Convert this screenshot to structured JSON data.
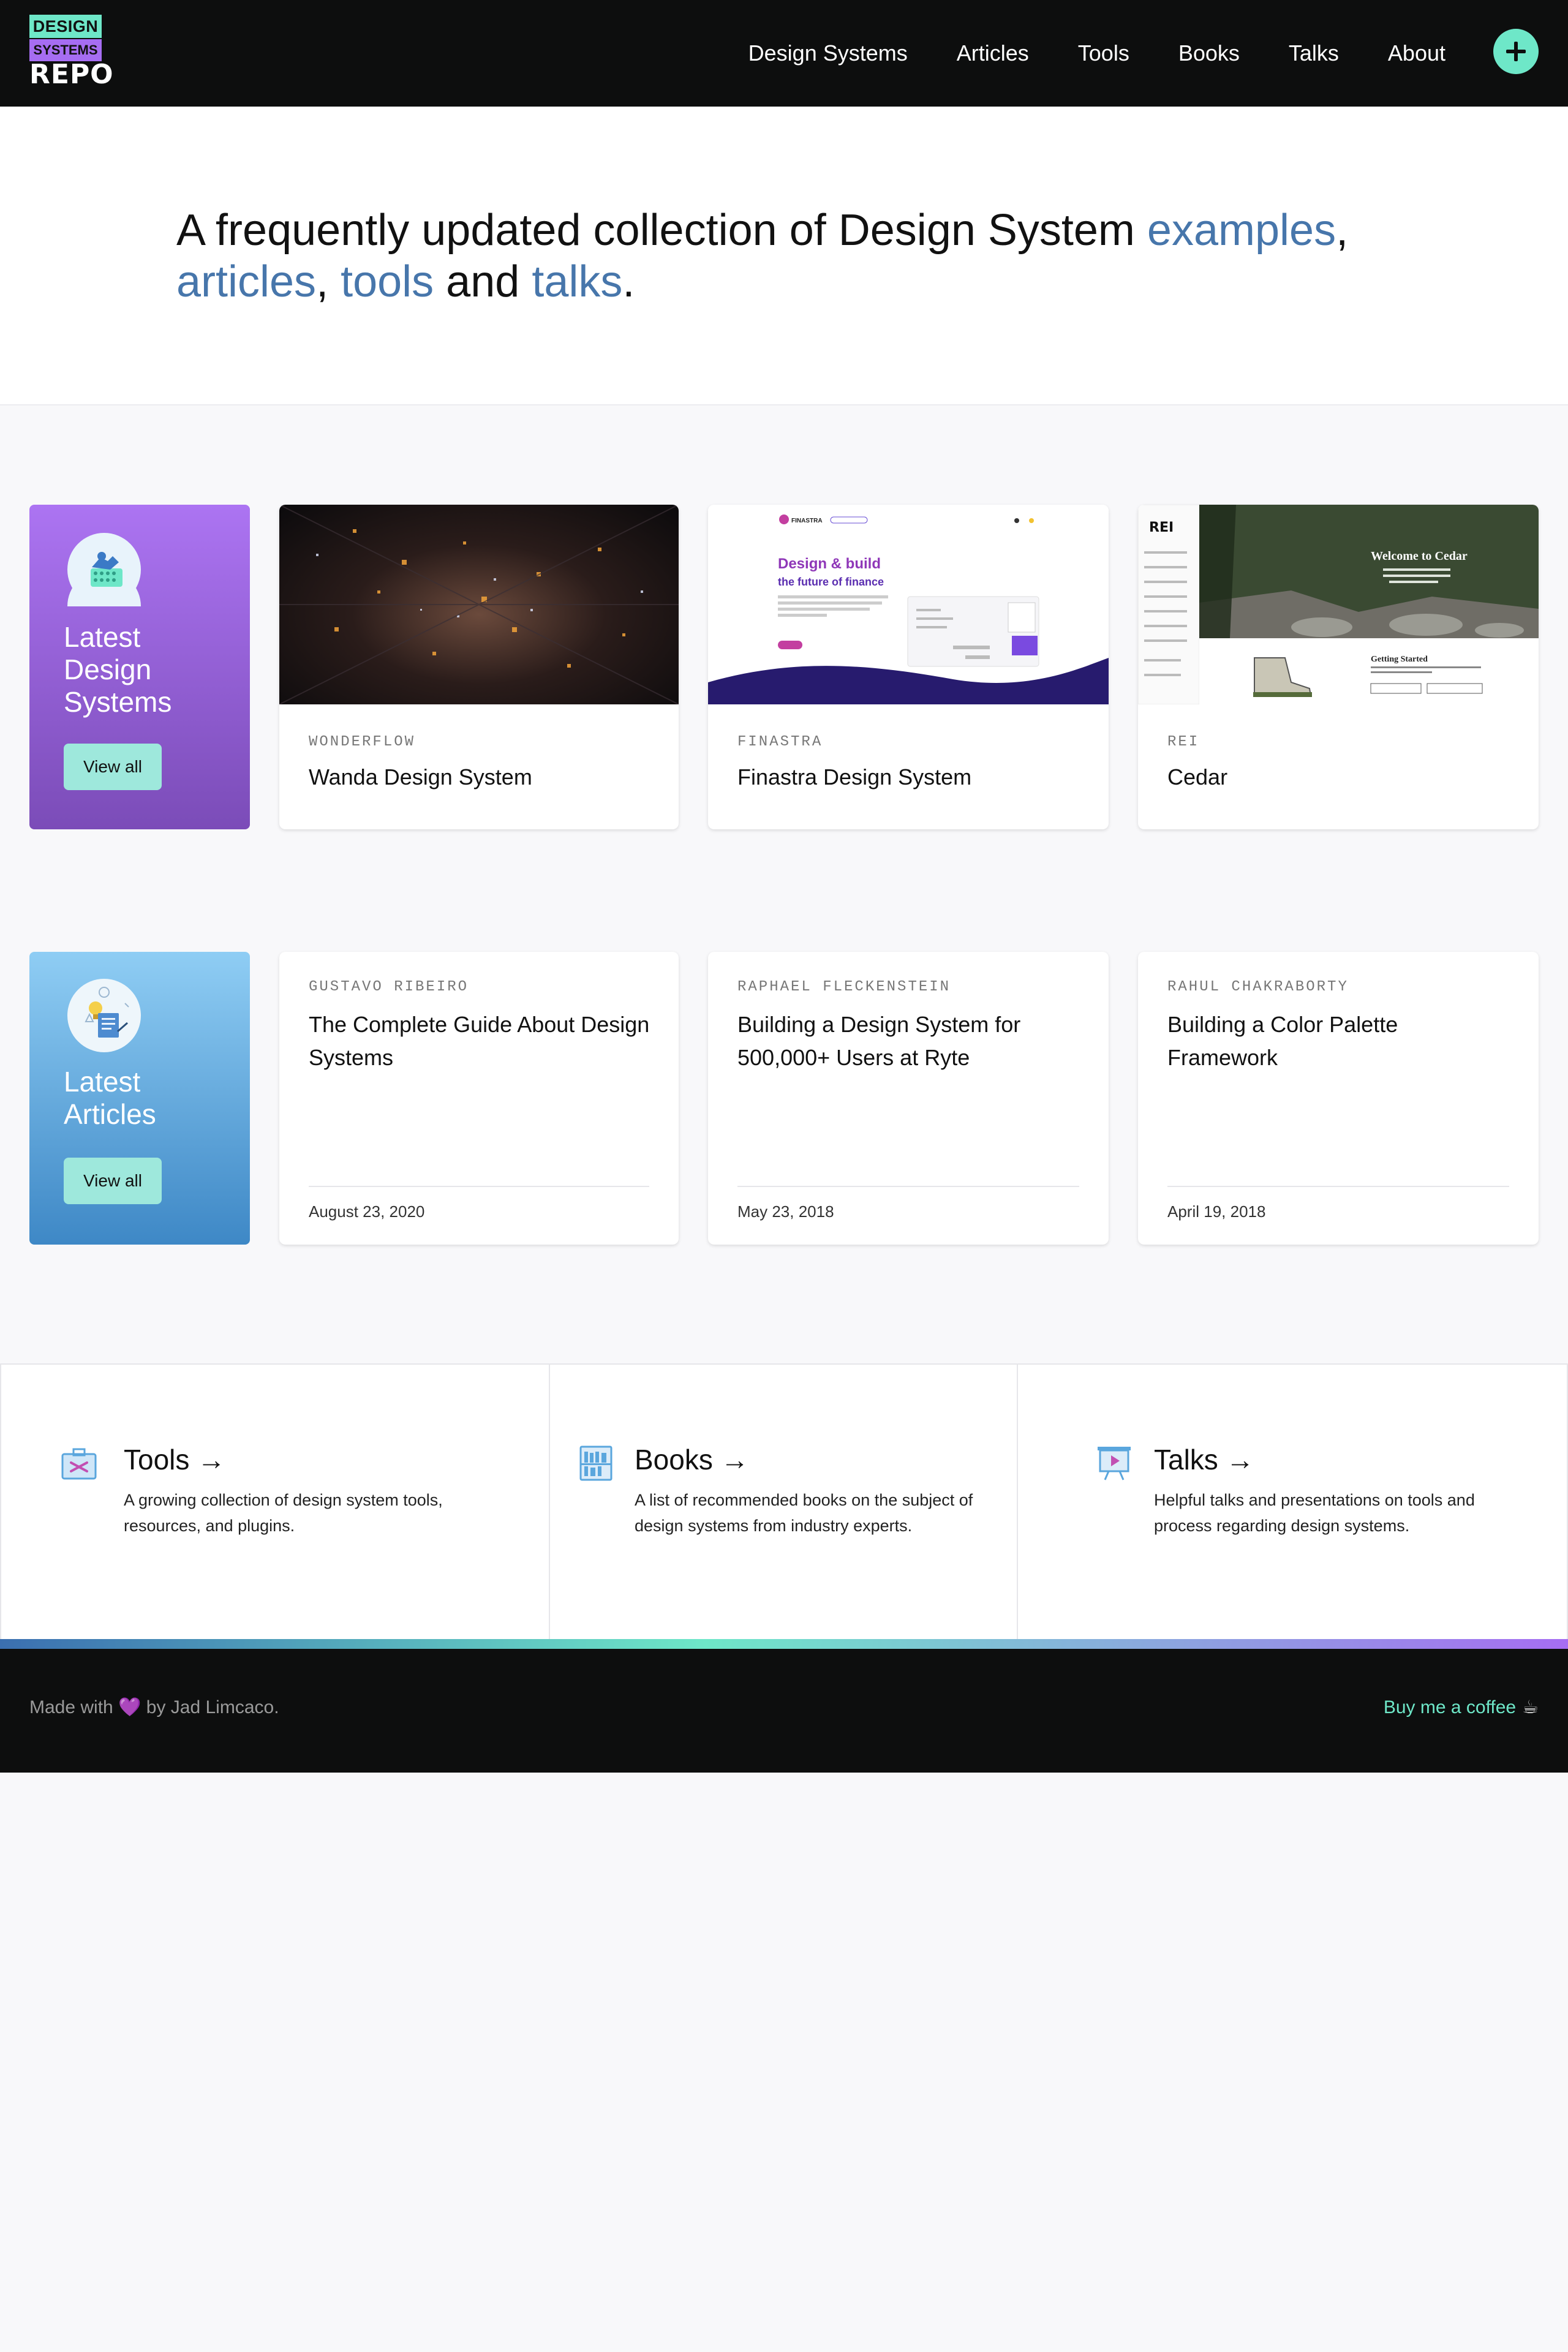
{
  "header": {
    "logo": {
      "line1": "DESIGN",
      "line2": "SYSTEMS",
      "line3": "REPO"
    },
    "nav": [
      "Design Systems",
      "Articles",
      "Tools",
      "Books",
      "Talks",
      "About"
    ],
    "add_icon": "plus-icon"
  },
  "hero": {
    "part1": "A frequently updated collection of Design System ",
    "link1": "examples",
    "sep1": ", ",
    "link2": "articles",
    "sep2": ", ",
    "link3": "tools",
    "sep3": " and ",
    "link4": "talks",
    "end": "."
  },
  "systems_section": {
    "promo_title": "Latest Design Systems",
    "promo_button": "View all",
    "cards": [
      {
        "meta": "WONDERFLOW",
        "title": "Wanda Design System"
      },
      {
        "meta": "FINASTRA",
        "title": "Finastra Design System",
        "thumb_heading": "Design & build the future of finance",
        "thumb_brand": "FINASTRA"
      },
      {
        "meta": "REI",
        "title": "Cedar",
        "thumb_heading": "Welcome to Cedar",
        "thumb_sub": "Getting Started",
        "thumb_brand": "REI"
      }
    ]
  },
  "articles_section": {
    "promo_title": "Latest Articles",
    "promo_button": "View all",
    "cards": [
      {
        "author": "GUSTAVO RIBEIRO",
        "title": "The Complete Guide About Design Systems",
        "date": "August 23, 2020"
      },
      {
        "author": "RAPHAEL FLECKENSTEIN",
        "title": "Building a Design System for 500,000+ Users at Ryte",
        "date": "May 23, 2018"
      },
      {
        "author": "RAHUL CHAKRABORTY",
        "title": "Building a Color Palette Framework",
        "date": "April 19, 2018"
      }
    ]
  },
  "links": [
    {
      "title": "Tools →",
      "desc": "A growing collection of design system tools, resources, and plugins.",
      "icon": "toolbox-icon"
    },
    {
      "title": "Books →",
      "desc": "A list of recommended books on the subject of design systems from industry experts.",
      "icon": "bookshelf-icon"
    },
    {
      "title": "Talks →",
      "desc": "Helpful talks and presentations on tools and process regarding design systems.",
      "icon": "presentation-icon"
    }
  ],
  "footer": {
    "made_pre": "Made with ",
    "heart": "💜",
    "made_post": " by Jad Limcaco.",
    "coffee": "Buy me a coffee",
    "coffee_icon": "☕"
  },
  "colors": {
    "accent_teal": "#6ee7c8",
    "accent_purple": "#a66df2",
    "link_blue": "#4776ab",
    "header_bg": "#0d0e0e"
  }
}
